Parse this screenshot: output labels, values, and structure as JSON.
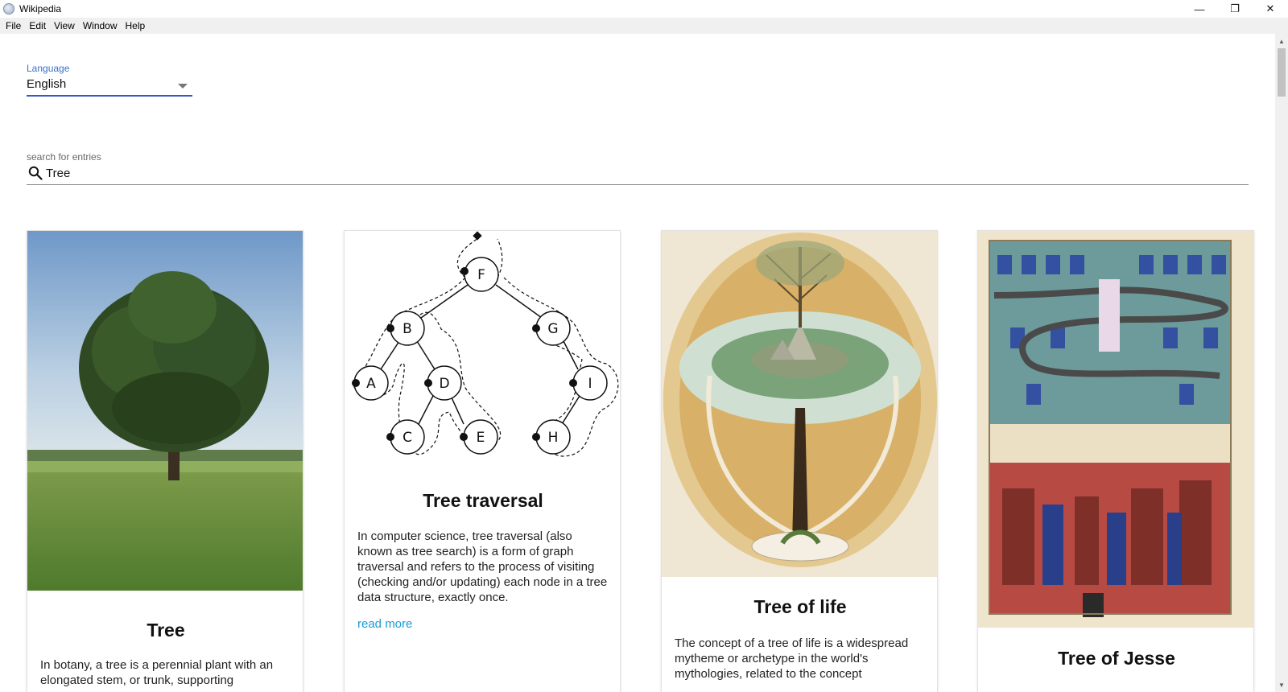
{
  "window": {
    "title": "Wikipedia",
    "minimize_glyph": "—",
    "restore_glyph": "❐",
    "close_glyph": "✕"
  },
  "menu": [
    "File",
    "Edit",
    "View",
    "Window",
    "Help"
  ],
  "language": {
    "label": "Language",
    "selected": "English"
  },
  "search": {
    "label": "search for entries",
    "value": "Tree"
  },
  "cards": [
    {
      "title": "Tree",
      "description": "In botany, a tree is a perennial plant with an elongated stem, or trunk, supporting"
    },
    {
      "title": "Tree traversal",
      "description": "In computer science, tree traversal (also known as tree search) is a form of graph traversal and refers to the process of visiting (checking and/or updating) each node in a tree data structure, exactly once.",
      "read_more": "read more",
      "diagram_nodes": [
        "F",
        "B",
        "G",
        "A",
        "D",
        "I",
        "C",
        "E",
        "H"
      ]
    },
    {
      "title": "Tree of life",
      "description": "The concept of a tree of life is a widespread mytheme or archetype in the world's mythologies, related to the concept"
    },
    {
      "title": "Tree of Jesse"
    }
  ],
  "colors": {
    "accent": "#3a56c4",
    "link": "#1a9bd7",
    "label": "#3a6fc8"
  }
}
